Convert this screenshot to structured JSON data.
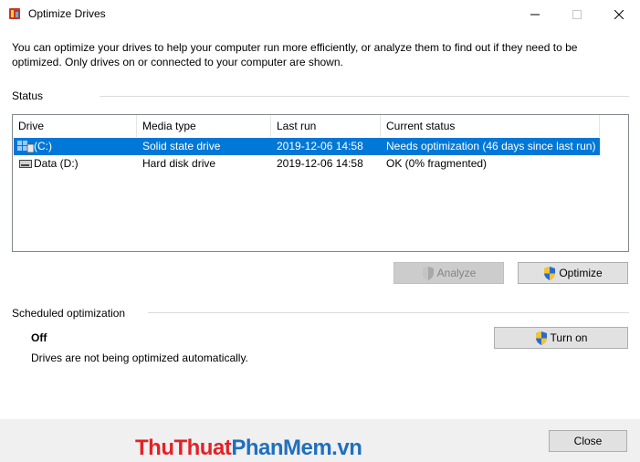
{
  "window": {
    "title": "Optimize Drives",
    "minimize_glyph": "—",
    "maximize_glyph": "☐",
    "close_glyph": "✕"
  },
  "intro_text": "You can optimize your drives to help your computer run more efficiently, or analyze them to find out if they need to be optimized. Only drives on or connected to your computer are shown.",
  "status_section": {
    "label": "Status",
    "columns": [
      "Drive",
      "Media type",
      "Last run",
      "Current status"
    ],
    "rows": [
      {
        "drive": "(C:)",
        "media_type": "Solid state drive",
        "last_run": "2019-12-06 14:58",
        "status": "Needs optimization (46 days since last run)",
        "selected": true
      },
      {
        "drive": "Data (D:)",
        "media_type": "Hard disk drive",
        "last_run": "2019-12-06 14:58",
        "status": "OK (0% fragmented)",
        "selected": false
      }
    ],
    "analyze_label": "Analyze",
    "optimize_label": "Optimize"
  },
  "scheduled_section": {
    "label": "Scheduled optimization",
    "state": "Off",
    "description": "Drives are not being optimized automatically.",
    "turn_on_label": "Turn on"
  },
  "watermark": {
    "part1": "ThuThuat",
    "part2": "PhanMem",
    "part3": ".vn"
  },
  "footer": {
    "close_label": "Close"
  },
  "colors": {
    "selection": "#0078d7",
    "watermark_red": "#e32227",
    "watermark_blue": "#1f6fbf"
  }
}
